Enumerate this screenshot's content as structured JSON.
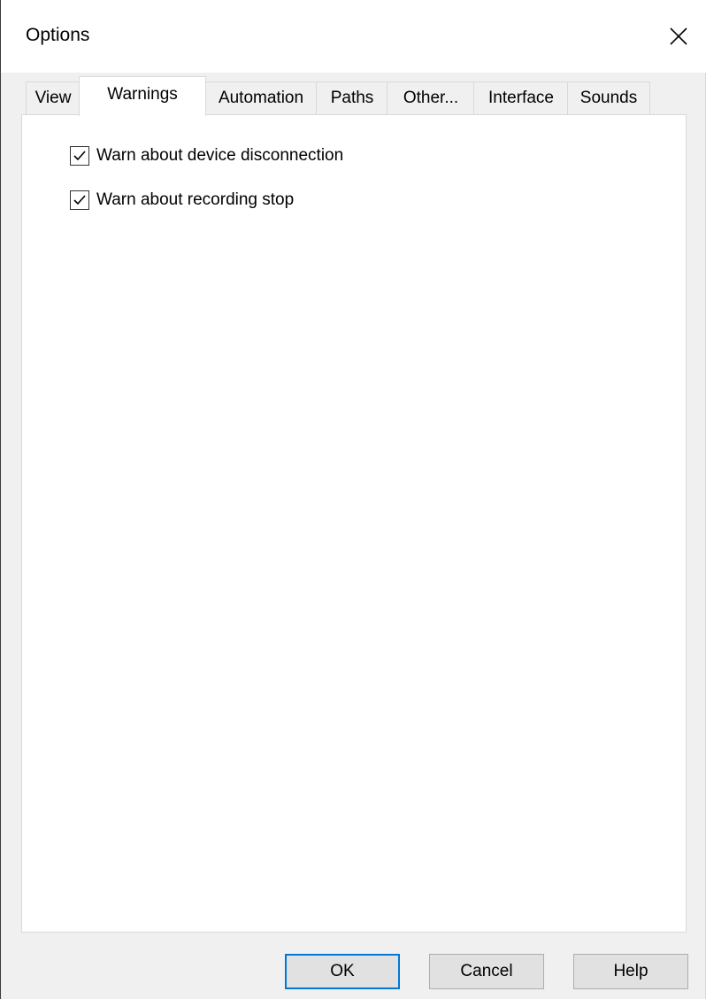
{
  "dialog": {
    "title": "Options",
    "close_icon": "close-icon"
  },
  "tabs": [
    {
      "label": "View",
      "active": false
    },
    {
      "label": "Warnings",
      "active": true
    },
    {
      "label": "Automation",
      "active": false
    },
    {
      "label": "Paths",
      "active": false
    },
    {
      "label": "Other...",
      "active": false
    },
    {
      "label": "Interface",
      "active": false
    },
    {
      "label": "Sounds",
      "active": false
    }
  ],
  "warnings": {
    "options": [
      {
        "label": "Warn about device disconnection",
        "checked": true
      },
      {
        "label": "Warn about recording stop",
        "checked": true
      }
    ]
  },
  "buttons": {
    "ok": "OK",
    "cancel": "Cancel",
    "help": "Help"
  },
  "colors": {
    "default_button_border": "#0078d7",
    "dialog_background": "#f0f0f0"
  }
}
